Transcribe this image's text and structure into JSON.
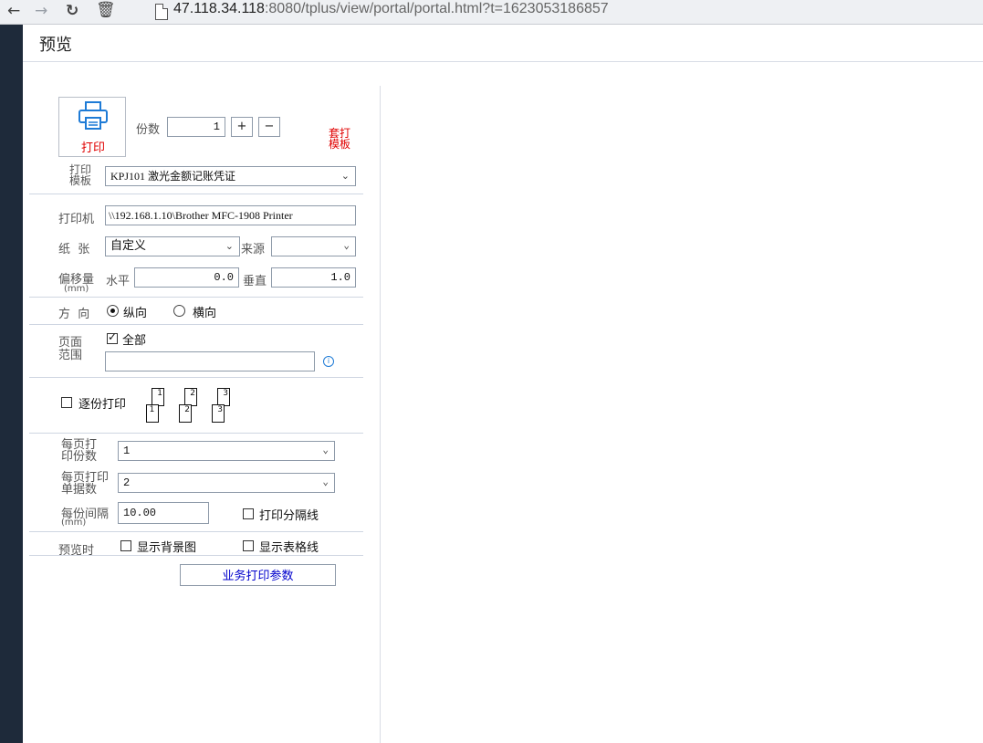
{
  "browser": {
    "url_host": "47.118.34.118",
    "url_rest": ":8080/tplus/view/portal/portal.html?t=1623053186857"
  },
  "window": {
    "title": "预览"
  },
  "print": {
    "print_button_label": "打印",
    "copies_label": "份数",
    "copies_value": "1",
    "plus_label": "+",
    "minus_label": "−",
    "template_print_label": "套打\n模板",
    "template_label": "打印\n模板",
    "template_value": "KPJ101 激光金额记账凭证",
    "printer_label": "打印机",
    "printer_value": "\\\\192.168.1.10\\Brother MFC-1908 Printer",
    "paper_label": "纸  张",
    "paper_value": "自定义",
    "source_label": "来源",
    "source_value": "",
    "offset_label": "偏移量",
    "offset_unit": "(mm)",
    "horizontal_label": "水平",
    "horizontal_value": "0.0",
    "vertical_label": "垂直",
    "vertical_value": "1.0",
    "orientation_label": "方  向",
    "portrait_label": "纵向",
    "landscape_label": "横向",
    "page_range_label": "页面\n范围",
    "all_label": "全部",
    "page_range_value": "",
    "info_icon": "info-icon",
    "collate_label": "逐份打印",
    "collate_numbers": [
      "1",
      "2",
      "3"
    ],
    "copies_per_page_label": "每页打\n印份数",
    "copies_per_page_value": "1",
    "docs_per_page_label": "每页打印\n单据数",
    "docs_per_page_value": "2",
    "spacing_label": "每份间隔",
    "spacing_unit": "(mm)",
    "spacing_value": "10.00",
    "print_separator_label": "打印分隔线",
    "preview_label": "预览时",
    "show_bg_label": "显示背景图",
    "show_grid_label": "显示表格线",
    "biz_params_label": "业务打印参数"
  },
  "colors": {
    "accent_red": "#e00000",
    "link_blue": "#0000cc",
    "printer_blue": "#1e7bd6"
  }
}
